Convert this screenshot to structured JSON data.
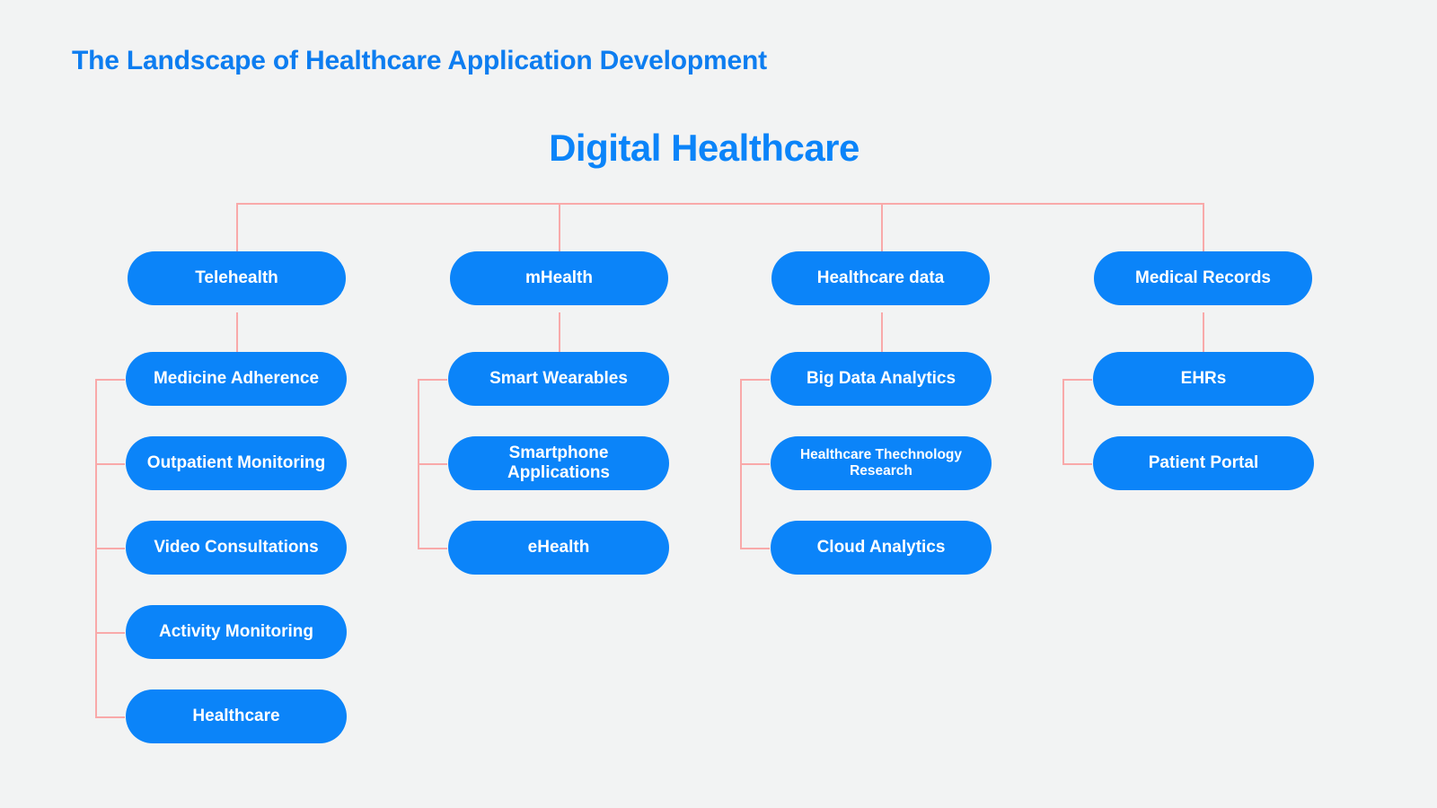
{
  "page": {
    "title": "The Landscape of Healthcare Application Development",
    "background_color": "#f2f3f3"
  },
  "colors": {
    "title_blue": "#0d7df0",
    "node_blue": "#0b84f9",
    "node_text": "#ffffff",
    "connector_pink": "#f9a9a9",
    "background": "#f2f3f3"
  },
  "diagram": {
    "root": "Digital Healthcare",
    "branches": [
      {
        "label": "Telehealth",
        "children": [
          "Medicine Adherence",
          "Outpatient Monitoring",
          "Video Consultations",
          "Activity Monitoring",
          "Healthcare"
        ]
      },
      {
        "label": "mHealth",
        "children": [
          "Smart Wearables",
          "Smartphone Applications",
          "eHealth"
        ]
      },
      {
        "label": "Healthcare data",
        "children": [
          "Big Data Analytics",
          "Healthcare Thechnology Research",
          "Cloud Analytics"
        ]
      },
      {
        "label": "Medical Records",
        "children": [
          "EHRs",
          "Patient Portal"
        ]
      }
    ]
  },
  "chart_data": {
    "type": "diagram",
    "subtype": "organizational-tree",
    "title": "The Landscape of Healthcare Application Development",
    "root": "Digital Healthcare",
    "levels": 3,
    "nodes": [
      {
        "id": "root",
        "label": "Digital Healthcare",
        "level": 0,
        "parent": null
      },
      {
        "id": "b1",
        "label": "Telehealth",
        "level": 1,
        "parent": "root"
      },
      {
        "id": "b2",
        "label": "mHealth",
        "level": 1,
        "parent": "root"
      },
      {
        "id": "b3",
        "label": "Healthcare data",
        "level": 1,
        "parent": "root"
      },
      {
        "id": "b4",
        "label": "Medical Records",
        "level": 1,
        "parent": "root"
      },
      {
        "id": "b1c1",
        "label": "Medicine Adherence",
        "level": 2,
        "parent": "b1"
      },
      {
        "id": "b1c2",
        "label": "Outpatient Monitoring",
        "level": 2,
        "parent": "b1"
      },
      {
        "id": "b1c3",
        "label": "Video Consultations",
        "level": 2,
        "parent": "b1"
      },
      {
        "id": "b1c4",
        "label": "Activity Monitoring",
        "level": 2,
        "parent": "b1"
      },
      {
        "id": "b1c5",
        "label": "Healthcare",
        "level": 2,
        "parent": "b1"
      },
      {
        "id": "b2c1",
        "label": "Smart Wearables",
        "level": 2,
        "parent": "b2"
      },
      {
        "id": "b2c2",
        "label": "Smartphone Applications",
        "level": 2,
        "parent": "b2"
      },
      {
        "id": "b2c3",
        "label": "eHealth",
        "level": 2,
        "parent": "b2"
      },
      {
        "id": "b3c1",
        "label": "Big Data Analytics",
        "level": 2,
        "parent": "b3"
      },
      {
        "id": "b3c2",
        "label": "Healthcare Thechnology Research",
        "level": 2,
        "parent": "b3"
      },
      {
        "id": "b3c3",
        "label": "Cloud Analytics",
        "level": 2,
        "parent": "b3"
      },
      {
        "id": "b4c1",
        "label": "EHRs",
        "level": 2,
        "parent": "b4"
      },
      {
        "id": "b4c2",
        "label": "Patient Portal",
        "level": 2,
        "parent": "b4"
      }
    ],
    "counts": {
      "branches": 4,
      "leaves": 13,
      "total_nodes": 18
    }
  }
}
